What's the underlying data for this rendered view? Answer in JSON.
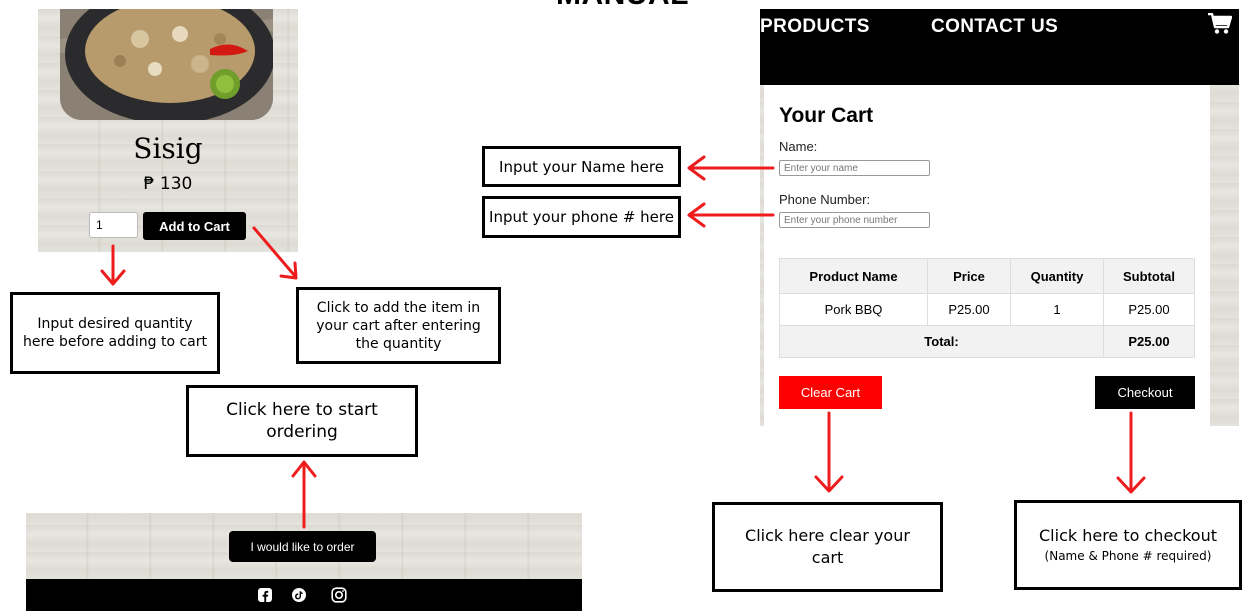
{
  "page": {
    "heading": "MANUAL"
  },
  "product": {
    "name": "Sisig",
    "price": "₱ 130",
    "quantity_value": "1",
    "add_to_cart_label": "Add to Cart"
  },
  "callouts": {
    "quantity": "Input desired quantity here before adding to cart",
    "add_to_cart": "Click to add the item in your cart after entering the quantity",
    "start_ordering": "Click here to start ordering",
    "name": "Input your Name here",
    "phone": "Input your phone # here",
    "clear_cart": "Click here clear your cart",
    "checkout_main": "Click here to checkout",
    "checkout_note": "(Name & Phone # required)"
  },
  "order": {
    "button_label": "I would like to order"
  },
  "footer": {
    "icons": [
      "facebook-icon",
      "tiktok-icon",
      "instagram-icon"
    ]
  },
  "nav": {
    "products": "PRODUCTS",
    "contact": "CONTACT US",
    "cart_icon": "cart-icon"
  },
  "cart": {
    "title": "Your Cart",
    "name_label": "Name:",
    "name_placeholder": "Enter your name",
    "phone_label": "Phone Number:",
    "phone_placeholder": "Enter your phone number",
    "columns": [
      "Product Name",
      "Price",
      "Quantity",
      "Subtotal"
    ],
    "rows": [
      {
        "product": "Pork BBQ",
        "price": "P25.00",
        "quantity": "1",
        "subtotal": "P25.00"
      }
    ],
    "total_label": "Total:",
    "total_value": "P25.00",
    "clear_label": "Clear Cart",
    "checkout_label": "Checkout"
  },
  "colors": {
    "accent": "#ff0000",
    "primary": "#000000",
    "arrow": "#ee1c1c"
  }
}
